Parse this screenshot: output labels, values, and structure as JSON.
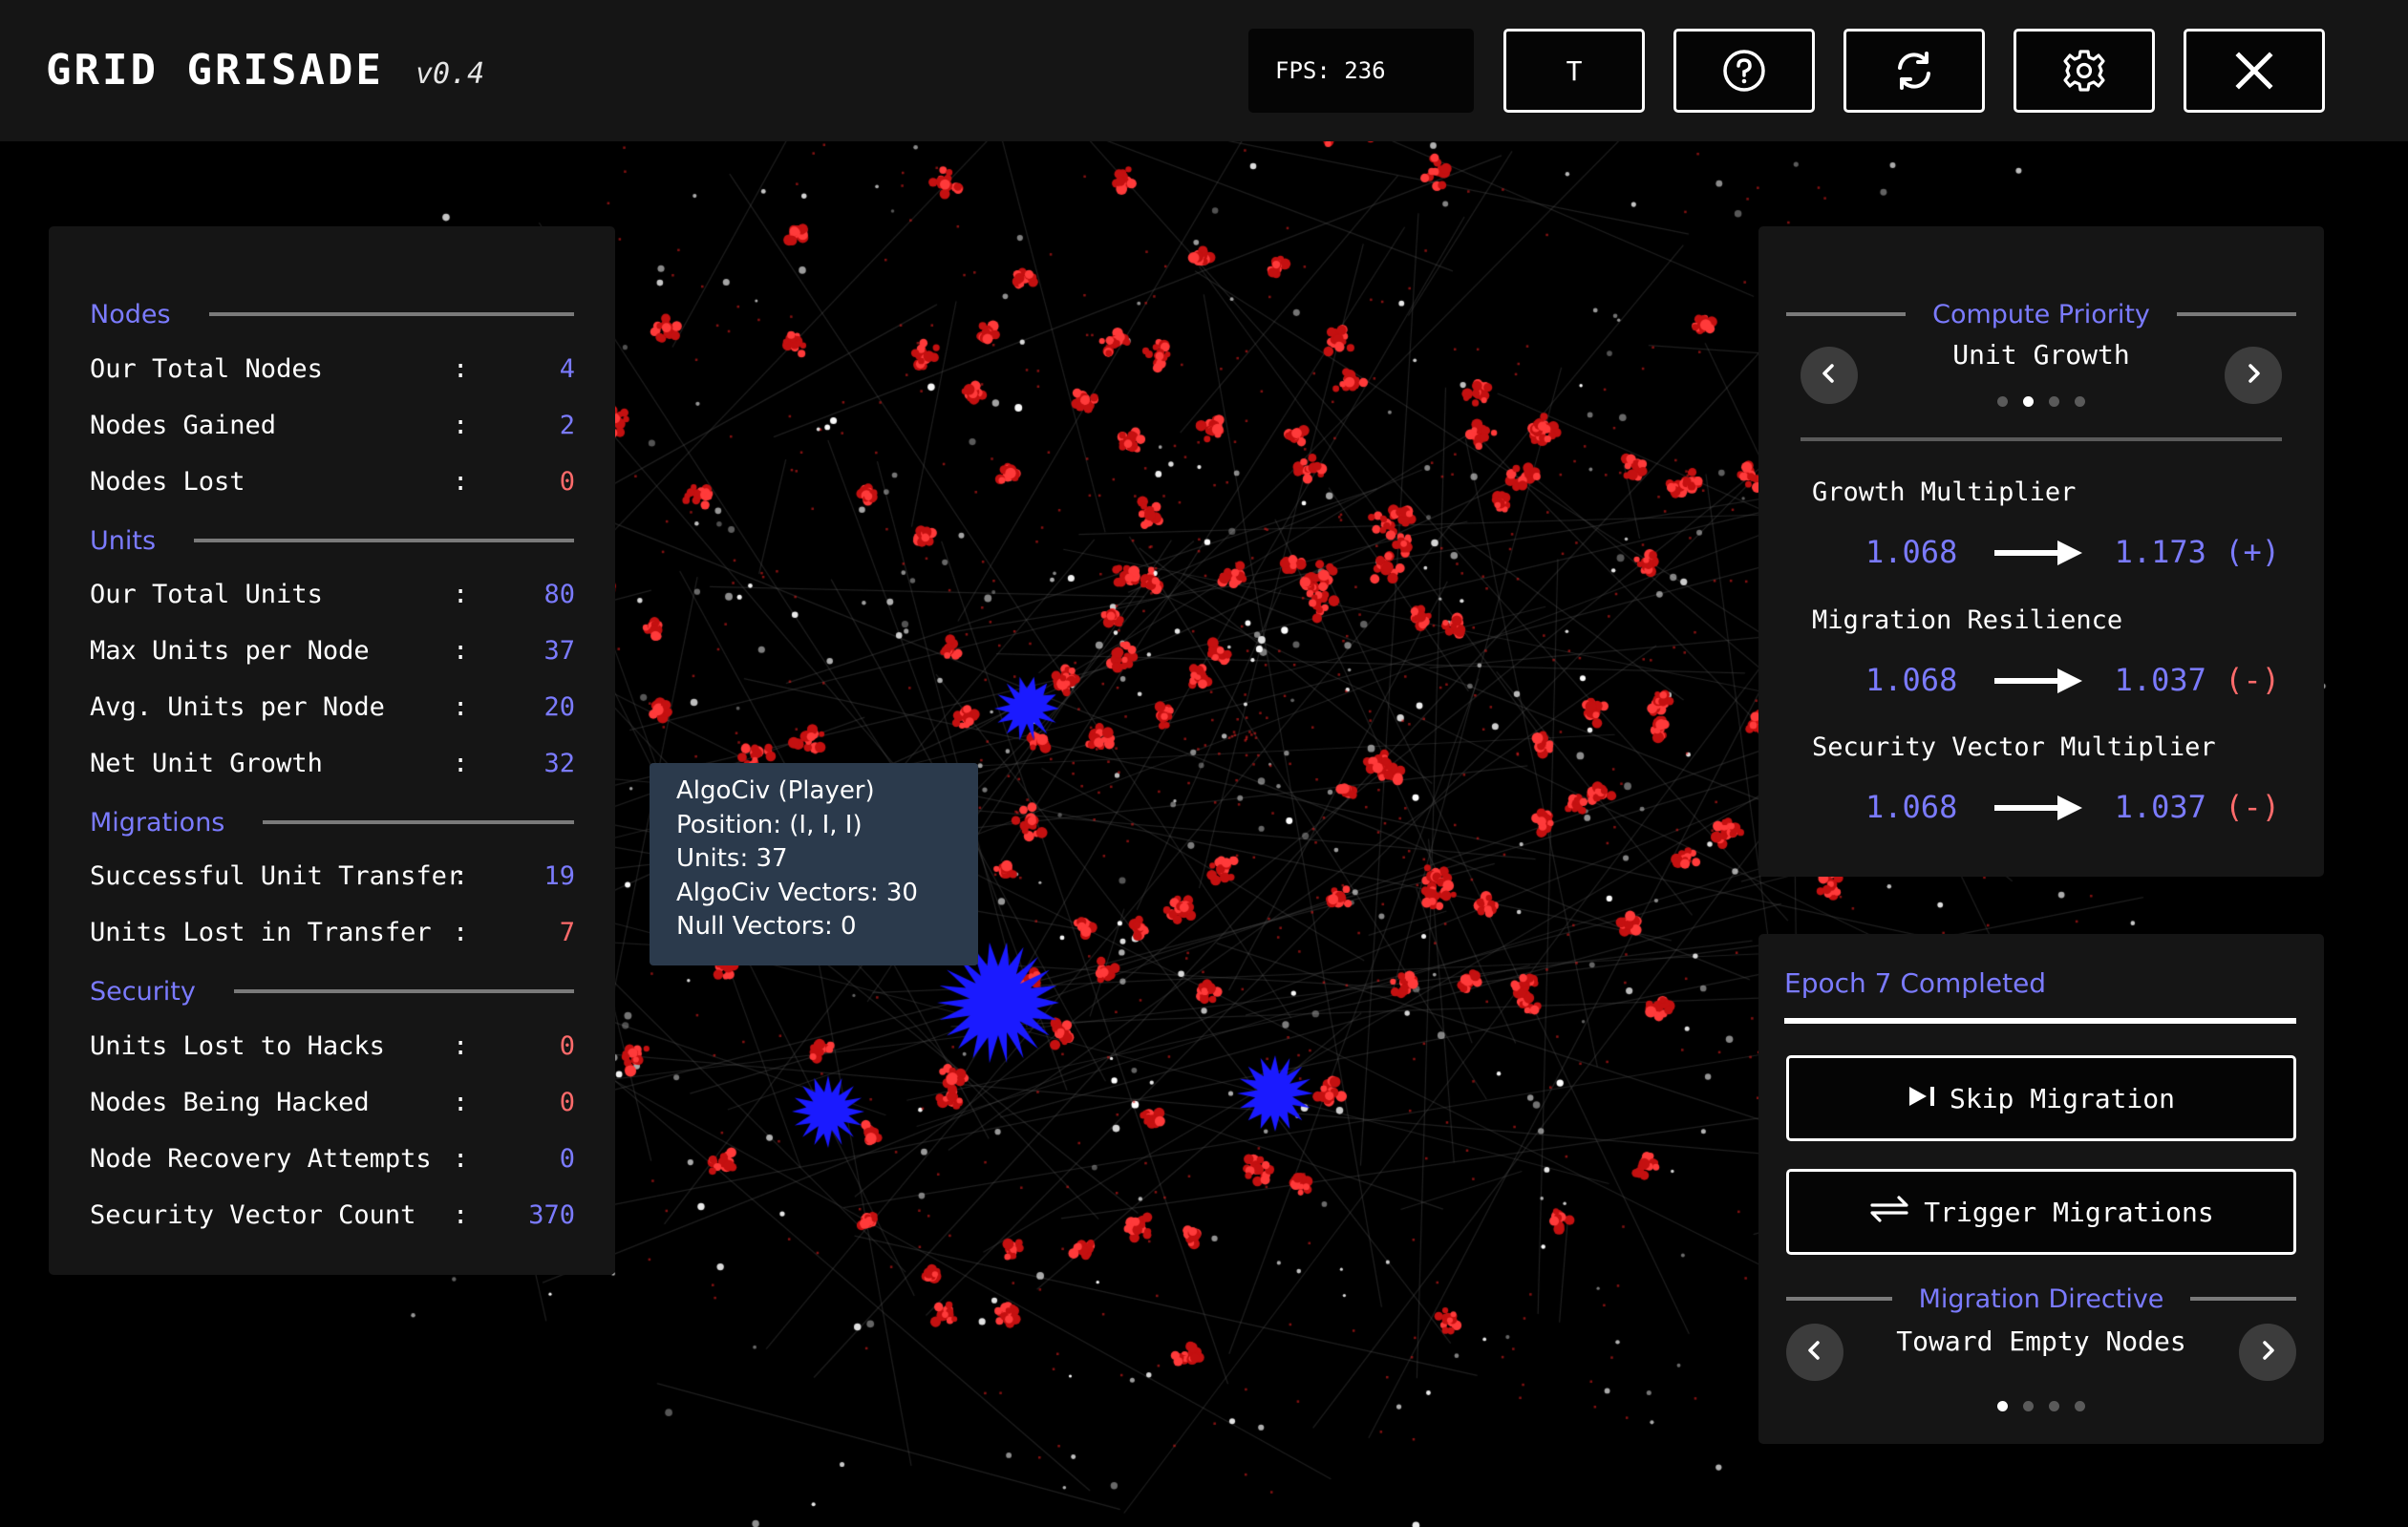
{
  "app": {
    "title": "GRID GRISADE",
    "version": "v0.4",
    "fps_text": "FPS: 236"
  },
  "toolbar": {
    "t_label": "T",
    "help_icon": "question-circle-icon",
    "reset_icon": "refresh-icon",
    "settings_icon": "gear-icon",
    "close_icon": "close-icon"
  },
  "stats": {
    "sections": [
      {
        "title": "Nodes",
        "rows": [
          {
            "label": "Our Total Nodes",
            "value": "4",
            "color": "blue"
          },
          {
            "label": "Nodes Gained",
            "value": "2",
            "color": "blue"
          },
          {
            "label": "Nodes Lost",
            "value": "0",
            "color": "red"
          }
        ]
      },
      {
        "title": "Units",
        "rows": [
          {
            "label": "Our Total Units",
            "value": "80",
            "color": "blue"
          },
          {
            "label": "Max Units per Node",
            "value": "37",
            "color": "blue"
          },
          {
            "label": "Avg. Units per Node",
            "value": "20",
            "color": "blue"
          },
          {
            "label": "Net Unit Growth",
            "value": "32",
            "color": "blue"
          }
        ]
      },
      {
        "title": "Migrations",
        "rows": [
          {
            "label": "Successful Unit Transfer",
            "value": "19",
            "color": "blue"
          },
          {
            "label": "Units Lost in Transfer",
            "value": "7",
            "color": "red"
          }
        ]
      },
      {
        "title": "Security",
        "rows": [
          {
            "label": "Units Lost to Hacks",
            "value": "0",
            "color": "red"
          },
          {
            "label": "Nodes Being Hacked",
            "value": "0",
            "color": "red"
          },
          {
            "label": "Node Recovery Attempts",
            "value": "0",
            "color": "blue"
          },
          {
            "label": "Security Vector Count",
            "value": "370",
            "color": "blue"
          }
        ]
      }
    ],
    "colon": ":"
  },
  "priority": {
    "title": "Compute Priority",
    "selected": "Unit Growth",
    "dot_count": 4,
    "active_dot": 1,
    "multipliers": [
      {
        "label": "Growth Multiplier",
        "from": "1.068",
        "to": "1.173",
        "delta": "(+)"
      },
      {
        "label": "Migration Resilience",
        "from": "1.068",
        "to": "1.037",
        "delta": "(-)"
      },
      {
        "label": "Security Vector Multiplier",
        "from": "1.068",
        "to": "1.037",
        "delta": "(-)"
      }
    ]
  },
  "migration": {
    "epoch_text": "Epoch 7 Completed",
    "skip_label": "Skip Migration",
    "trigger_label": "Trigger Migrations",
    "directive_title": "Migration Directive",
    "directive_selected": "Toward Empty Nodes",
    "dot_count": 4,
    "active_dot": 0
  },
  "tooltip": {
    "lines": [
      "AlgoCiv (Player)",
      "Position: (I, I, I)",
      "Units: 37",
      "AlgoCiv Vectors: 30",
      "Null Vectors: 0"
    ]
  },
  "colors": {
    "accent_blue": "#7b7bff",
    "enemy_red": "#e01b1b",
    "player_blue": "#1a1aff",
    "panel_bg": "#151515",
    "tooltip_bg": "#2b3a4c"
  }
}
